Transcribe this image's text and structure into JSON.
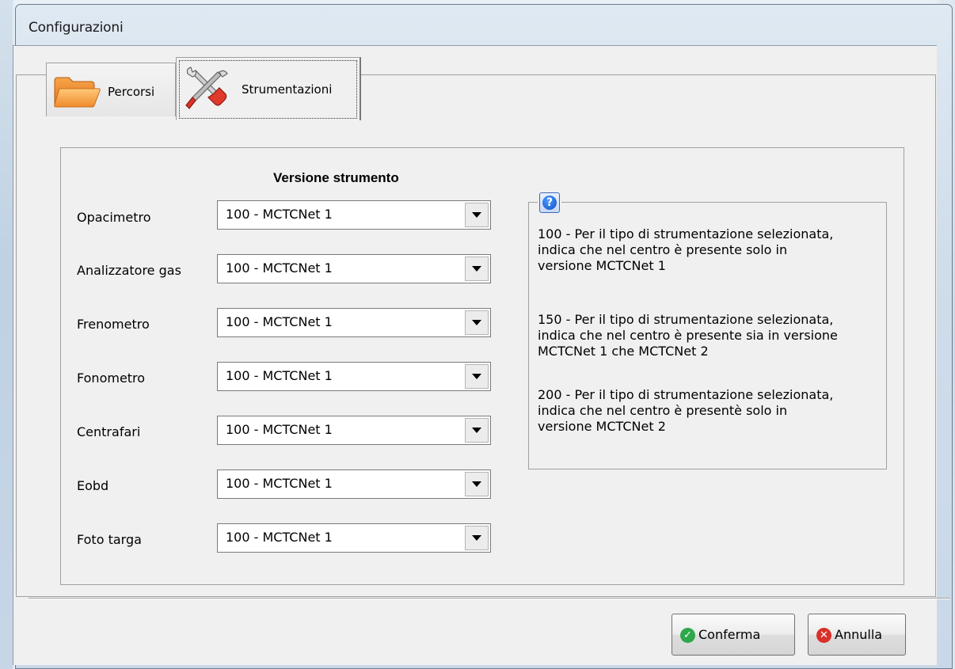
{
  "window": {
    "title": "Configurazioni"
  },
  "tabs": [
    {
      "label": "Percorsi",
      "icon": "folder-icon",
      "active": false
    },
    {
      "label": "Strumentazioni",
      "icon": "tools-icon",
      "active": true
    }
  ],
  "section": {
    "heading": "Versione strumento"
  },
  "instruments": [
    {
      "label": "Opacimetro",
      "value": "100 - MCTCNet 1"
    },
    {
      "label": "Analizzatore gas",
      "value": "100 - MCTCNet 1"
    },
    {
      "label": "Frenometro",
      "value": "100 - MCTCNet 1"
    },
    {
      "label": "Fonometro",
      "value": "100 - MCTCNet 1"
    },
    {
      "label": "Centrafari",
      "value": "100 - MCTCNet 1"
    },
    {
      "label": "Eobd",
      "value": "100 - MCTCNet 1"
    },
    {
      "label": "Foto targa",
      "value": "100 - MCTCNet 1"
    }
  ],
  "help": {
    "icon": "help-icon",
    "paragraphs": [
      "100 - Per il tipo di strumentazione selezionata,\nindica che nel centro è presente solo in\nversione MCTCNet 1",
      "150 - Per il tipo di strumentazione selezionata,\nindica che nel centro è presente sia in versione\nMCTCNet 1 che MCTCNet 2",
      "200 - Per il tipo di strumentazione selezionata,\nindica che nel centro è presentè solo in\nversione MCTCNet 2"
    ]
  },
  "buttons": {
    "confirm": {
      "label": "Conferma",
      "icon": "check-icon",
      "color": "#2ea84a"
    },
    "cancel": {
      "label": "Annulla",
      "icon": "close-icon",
      "color": "#d8302a"
    }
  }
}
